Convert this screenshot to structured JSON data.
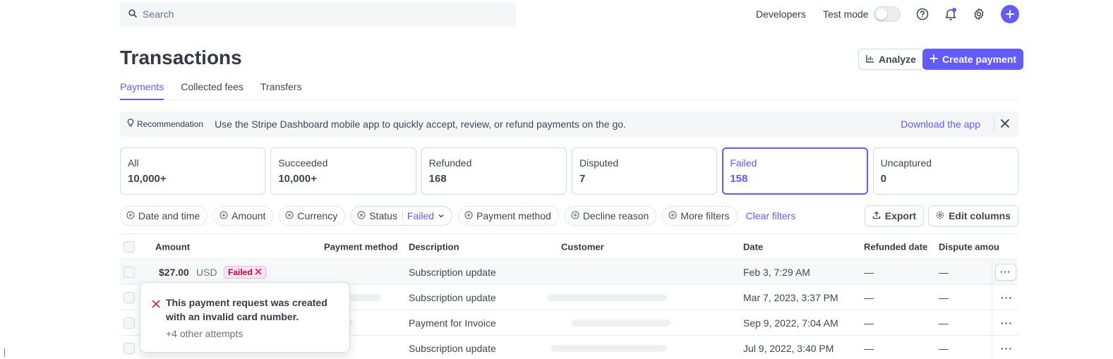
{
  "topbar": {
    "search_placeholder": "Search",
    "developers": "Developers",
    "test_mode": "Test mode",
    "icons": [
      "search-icon",
      "help-icon",
      "bell-icon",
      "gear-icon",
      "plus-icon"
    ]
  },
  "header": {
    "title": "Transactions",
    "analyze": "Analyze",
    "create_payment": "Create payment"
  },
  "tabs": [
    {
      "label": "Payments",
      "active": true
    },
    {
      "label": "Collected fees",
      "active": false
    },
    {
      "label": "Transfers",
      "active": false
    }
  ],
  "recommendation": {
    "tag": "Recommendation",
    "message": "Use the Stripe Dashboard mobile app to quickly accept, review, or refund payments on the go.",
    "link": "Download the app"
  },
  "status_cards": [
    {
      "label": "All",
      "value": "10,000+"
    },
    {
      "label": "Succeeded",
      "value": "10,000+"
    },
    {
      "label": "Refunded",
      "value": "168"
    },
    {
      "label": "Disputed",
      "value": "7"
    },
    {
      "label": "Failed",
      "value": "158",
      "active": true
    },
    {
      "label": "Uncaptured",
      "value": "0"
    }
  ],
  "filters": {
    "date_time": "Date and time",
    "amount": "Amount",
    "currency": "Currency",
    "status": "Status",
    "status_value": "Failed",
    "payment_method": "Payment method",
    "decline_reason": "Decline reason",
    "more_filters": "More filters",
    "clear": "Clear filters",
    "export": "Export",
    "edit_columns": "Edit columns"
  },
  "table": {
    "columns": [
      "Amount",
      "Payment method",
      "Description",
      "Customer",
      "Date",
      "Refunded date",
      "Dispute amou"
    ],
    "rows": [
      {
        "amount": "$27.00",
        "currency": "USD",
        "status": "Failed",
        "description": "Subscription update",
        "date": "Feb 3, 7:29 AM",
        "refunded": "—",
        "dispute": "—"
      },
      {
        "description": "Subscription update",
        "date": "Mar 7, 2023, 3:37 PM",
        "refunded": "—",
        "dispute": "—"
      },
      {
        "description": "Payment for Invoice",
        "date": "Sep 9, 2022, 7:04 AM",
        "refunded": "—",
        "dispute": "—"
      },
      {
        "description": "Subscription update",
        "date": "Jul 9, 2022, 3:40 PM",
        "refunded": "—",
        "dispute": "—"
      }
    ],
    "more": "···"
  },
  "tooltip": {
    "message": "This payment request was created with an invalid card number.",
    "attempts": "+4 other attempts"
  },
  "colors": {
    "accent": "#635bff",
    "danger": "#df1b41"
  }
}
